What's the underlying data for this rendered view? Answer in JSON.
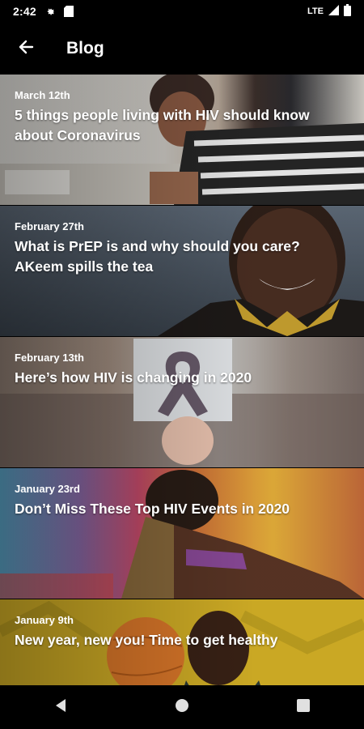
{
  "status_bar": {
    "time": "2:42",
    "network": "LTE",
    "icons": [
      "settings-gear-icon",
      "sim-card-icon",
      "signal-icon",
      "battery-icon"
    ]
  },
  "app_bar": {
    "title": "Blog",
    "back_icon": "arrow-left-icon"
  },
  "posts": [
    {
      "date": "March 12th",
      "title": "5 things people living with HIV should know about Coronavirus"
    },
    {
      "date": "February 27th",
      "title": "What is PrEP is and why should you care? AKeem spills the tea"
    },
    {
      "date": "February 13th",
      "title": "Here’s how HIV is changing in 2020"
    },
    {
      "date": "January 23rd",
      "title": "Don’t Miss These Top HIV Events in 2020"
    },
    {
      "date": "January 9th",
      "title": "New year, new you! Time to get healthy"
    }
  ],
  "nav_bar": {
    "buttons": [
      "back-triangle-icon",
      "home-circle-icon",
      "recents-square-icon"
    ]
  },
  "colors": {
    "background": "#000000",
    "text": "#ffffff",
    "card_1": "#d9d6cf",
    "card_2": "#3b4450",
    "card_3": "#b9a89a",
    "card_4": "#c46a3a",
    "card_5": "#d8b52a"
  }
}
